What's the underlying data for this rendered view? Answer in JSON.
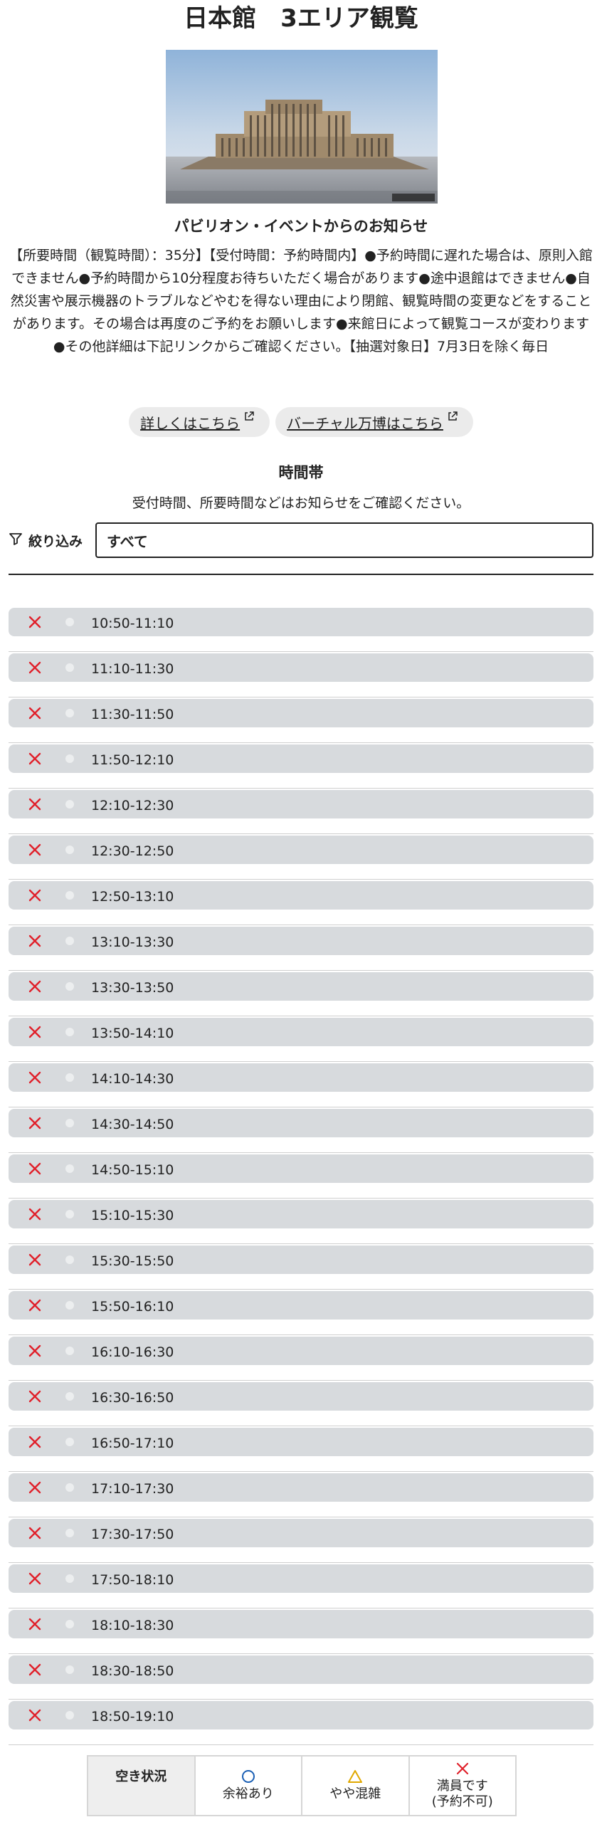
{
  "page": {
    "title": "日本館　3エリア観覧"
  },
  "notice": {
    "heading": "パビリオン・イベントからのお知らせ",
    "body": "【所要時間（観覧時間）：35分】【受付時間：予約時間内】●予約時間に遅れた場合は、原則入館できません●予約時間から10分程度お待ちいただく場合があります●途中退館はできません●自然災害や展示機器のトラブルなどやむを得ない理由により閉館、観覧時間の変更などをすることがあります。その場合は再度のご予約をお願いします●来館日によって観覧コースが変わります●その他詳細は下記リンクからご確認ください。【抽選対象日】7月3日を除く毎日",
    "photo_credit": "画像：経済産業省"
  },
  "links": {
    "details": "詳しくはこちら",
    "virtual": "バーチャル万博はこちら",
    "external_icon": "external-link-icon"
  },
  "timeslots": {
    "heading": "時間帯",
    "subtext": "受付時間、所要時間などはお知らせをご確認ください。",
    "filter_label": "絞り込み",
    "filter_icon": "filter-icon",
    "filter_value": "すべて",
    "slots": [
      {
        "time": "10:50-11:10",
        "status": "full"
      },
      {
        "time": "11:10-11:30",
        "status": "full"
      },
      {
        "time": "11:30-11:50",
        "status": "full"
      },
      {
        "time": "11:50-12:10",
        "status": "full"
      },
      {
        "time": "12:10-12:30",
        "status": "full"
      },
      {
        "time": "12:30-12:50",
        "status": "full"
      },
      {
        "time": "12:50-13:10",
        "status": "full"
      },
      {
        "time": "13:10-13:30",
        "status": "full"
      },
      {
        "time": "13:30-13:50",
        "status": "full"
      },
      {
        "time": "13:50-14:10",
        "status": "full"
      },
      {
        "time": "14:10-14:30",
        "status": "full"
      },
      {
        "time": "14:30-14:50",
        "status": "full"
      },
      {
        "time": "14:50-15:10",
        "status": "full"
      },
      {
        "time": "15:10-15:30",
        "status": "full"
      },
      {
        "time": "15:30-15:50",
        "status": "full"
      },
      {
        "time": "15:50-16:10",
        "status": "full"
      },
      {
        "time": "16:10-16:30",
        "status": "full"
      },
      {
        "time": "16:30-16:50",
        "status": "full"
      },
      {
        "time": "16:50-17:10",
        "status": "full"
      },
      {
        "time": "17:10-17:30",
        "status": "full"
      },
      {
        "time": "17:30-17:50",
        "status": "full"
      },
      {
        "time": "17:50-18:10",
        "status": "full"
      },
      {
        "time": "18:10-18:30",
        "status": "full"
      },
      {
        "time": "18:30-18:50",
        "status": "full"
      },
      {
        "time": "18:50-19:10",
        "status": "full"
      }
    ]
  },
  "legend": {
    "title": "空き状況",
    "available": "余裕あり",
    "busy": "やや混雑",
    "full_line1": "満員です",
    "full_line2": "(予約不可)"
  },
  "colors": {
    "full_mark": "#e0202a",
    "available_mark": "#1a5fb4",
    "busy_mark": "#e0a800",
    "slot_bg": "#d7dadd"
  }
}
